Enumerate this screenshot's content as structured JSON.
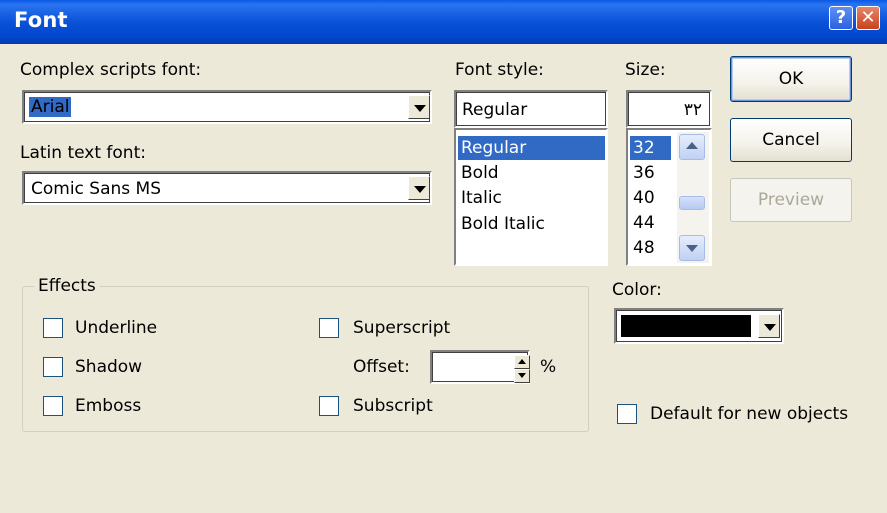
{
  "window": {
    "title": "Font",
    "help_glyph": "?",
    "close_glyph": "✕"
  },
  "complex_font": {
    "label": "Complex scripts font:",
    "value": "Arial"
  },
  "latin_font": {
    "label": "Latin text font:",
    "value": "Comic Sans MS"
  },
  "font_style": {
    "label": "Font style:",
    "value": "Regular",
    "options": [
      "Regular",
      "Bold",
      "Italic",
      "Bold Italic"
    ]
  },
  "size": {
    "label": "Size:",
    "value": "٣٢",
    "options": [
      "32",
      "36",
      "40",
      "44",
      "48"
    ]
  },
  "buttons": {
    "ok": "OK",
    "cancel": "Cancel",
    "preview": "Preview"
  },
  "effects": {
    "label": "Effects",
    "underline": "Underline",
    "shadow": "Shadow",
    "emboss": "Emboss",
    "superscript": "Superscript",
    "offset_label": "Offset:",
    "offset_value": "",
    "percent": "%",
    "subscript": "Subscript"
  },
  "color": {
    "label": "Color:",
    "swatch": "#000000"
  },
  "default_checkbox": {
    "label": "Default for new objects"
  },
  "colors": {
    "title_bar": "#0A52D8",
    "selection": "#316AC5",
    "dialog_bg": "#ECE9D8"
  },
  "icons": {
    "help": "help-icon",
    "close": "close-icon"
  }
}
